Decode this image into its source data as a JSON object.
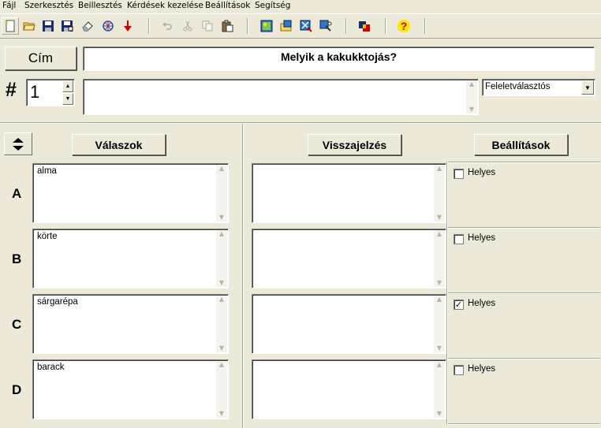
{
  "menu": [
    "Fájl",
    "Szerkesztés",
    "Beillesztés",
    "Kérdések kezelése",
    "Beállítások",
    "Segítség"
  ],
  "toolbar": {
    "icons": [
      "new-file-icon",
      "open-folder-icon",
      "save-icon",
      "save-as-icon",
      "eraser-icon",
      "web-icon",
      "down-arrow-icon",
      "undo-icon",
      "cut-icon",
      "copy-icon",
      "paste-icon",
      "image-insert-icon",
      "image-open-icon",
      "image-export-icon",
      "image-tool-icon",
      "colors-icon",
      "help-icon"
    ],
    "help_label": "?"
  },
  "header": {
    "title_button": "Cím",
    "title_value": "Melyik a kakukktojás?",
    "number_symbol": "#",
    "number_value": "1",
    "question_text": "",
    "type_select": "Feleletválasztós"
  },
  "columns": {
    "answers": "Válaszok",
    "feedback": "Visszajelzés",
    "settings": "Beállítások"
  },
  "rows": [
    {
      "letter": "A",
      "answer": "alma",
      "feedback": "",
      "correct_label": "Helyes",
      "correct": false
    },
    {
      "letter": "B",
      "answer": "körte",
      "feedback": "",
      "correct_label": "Helyes",
      "correct": false
    },
    {
      "letter": "C",
      "answer": "sárgarépa",
      "feedback": "",
      "correct_label": "Helyes",
      "correct": true
    },
    {
      "letter": "D",
      "answer": "barack",
      "feedback": "",
      "correct_label": "Helyes",
      "correct": false
    }
  ],
  "check_mark": "✓"
}
